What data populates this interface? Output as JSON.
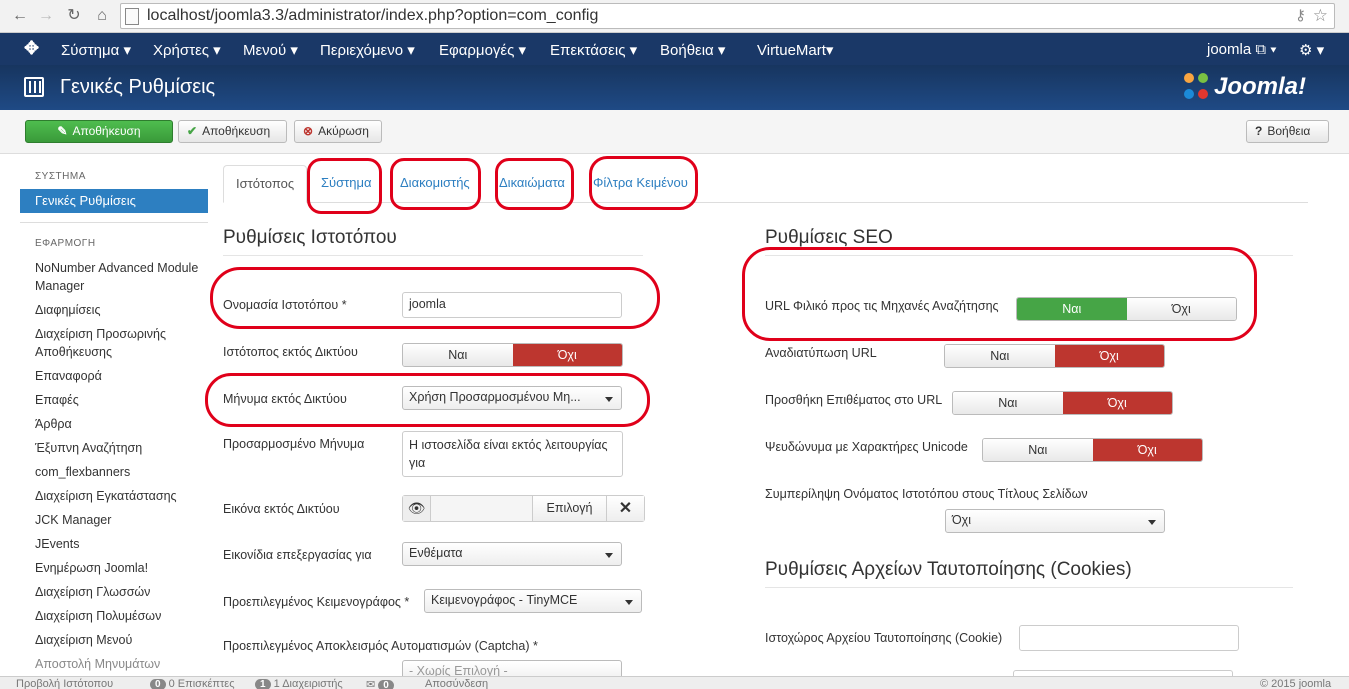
{
  "browser": {
    "url": "localhost/joomla3.3/administrator/index.php?option=com_config"
  },
  "navbar": {
    "menu": [
      "Σύστημα ▾",
      "Χρήστες ▾",
      "Μενού ▾",
      "Περιεχόμενο ▾",
      "Εφαρμογές ▾",
      "Επεκτάσεις ▾",
      "Βοήθεια ▾",
      "VirtueMart▾"
    ],
    "user": "joomla ⧉ ▾",
    "settings": "⚙ ▾"
  },
  "header": {
    "title": "Γενικές Ρυθμίσεις",
    "logo_text": "Joomla!"
  },
  "toolbar": {
    "save_close": "Αποθήκευση",
    "save": "Αποθήκευση",
    "cancel": "Ακύρωση",
    "help": "Βοήθεια"
  },
  "sidebar": {
    "system_head": "ΣΥΣΤΗΜΑ",
    "active": "Γενικές Ρυθμίσεις",
    "app_head": "ΕΦΑΡΜΟΓΗ",
    "items": [
      "NoNumber Advanced Module Manager",
      "Διαφημίσεις",
      "Διαχείριση Προσωρινής Αποθήκευσης",
      "Επαναφορά",
      "Επαφές",
      "Άρθρα",
      "Έξυπνη Αναζήτηση",
      "com_flexbanners",
      "Διαχείριση Εγκατάστασης",
      "JCK Manager",
      "JEvents",
      "Ενημέρωση Joomla!",
      "Διαχείριση Γλωσσών",
      "Διαχείριση Πολυμέσων",
      "Διαχείριση Μενού",
      "Αποστολή Μηνυμάτων"
    ]
  },
  "tabs": [
    "Ιστότοπος",
    "Σύστημα",
    "Διακομιστής",
    "Δικαιώματα",
    "Φίλτρα Κειμένου"
  ],
  "site": {
    "heading": "Ρυθμίσεις Ιστοτόπου",
    "sitename_label": "Ονομασία Ιστοτόπου *",
    "sitename_value": "joomla",
    "offline_label": "Ιστότοπος εκτός Δικτύου",
    "offline_msg_label": "Μήνυμα εκτός Δικτύου",
    "offline_msg_value": "Χρήση Προσαρμοσμένου Μη...",
    "custom_msg_label": "Προσαρμοσμένο Μήνυμα",
    "custom_msg_value": "Η ιστοσελίδα είναι εκτός λειτουργίας για",
    "offline_image_label": "Εικόνα εκτός Δικτύου",
    "select_btn": "Επιλογή",
    "toolbar_icons_label": "Εικονίδια επεξεργασίας για",
    "toolbar_icons_value": "Ενθέματα",
    "editor_label": "Προεπιλεγμένος Κειμενογράφος *",
    "editor_value": "Κειμενογράφος - TinyMCE",
    "captcha_label": "Προεπιλεγμένος Αποκλεισμός Αυτοματισμών (Captcha) *",
    "captcha_value": "- Χωρίς Επιλογή -"
  },
  "seo": {
    "heading": "Ρυθμίσεις SEO",
    "sef_label": "URL Φιλικό προς τις Μηχανές Αναζήτησης",
    "rewrite_label": "Αναδιατύπωση URL",
    "suffix_label": "Προσθήκη Επιθέματος στο URL",
    "unicode_label": "Ψευδώνυμα με Χαρακτήρες Unicode",
    "sitename_pages_label": "Συμπερίληψη Ονόματος Ιστοτόπου στους Τίτλους Σελίδων",
    "sitename_pages_value": "Όχι"
  },
  "cookie": {
    "heading": "Ρυθμίσεις Αρχείων Ταυτοποίησης (Cookies)",
    "domain_label": "Ιστοχώρος Αρχείου Ταυτοποίησης (Cookie)"
  },
  "yes": "Ναι",
  "no": "Όχι",
  "status": {
    "view_site": "Προβολή Ιστότοπου",
    "visitors_count": "0",
    "visitors": "0 Επισκέπτες",
    "admins_count": "1",
    "admins": "1 Διαχειριστής",
    "messages_count": "0",
    "logout": "Αποσύνδεση",
    "copyright": "© 2015 joomla"
  },
  "colors": {
    "navbar": "#1a3867",
    "header": "#1c3d6e",
    "toggle_on_red": "#bd362f",
    "toggle_on_green": "#46a546",
    "annotation": "#e0001a",
    "link": "#2d7fc1"
  }
}
